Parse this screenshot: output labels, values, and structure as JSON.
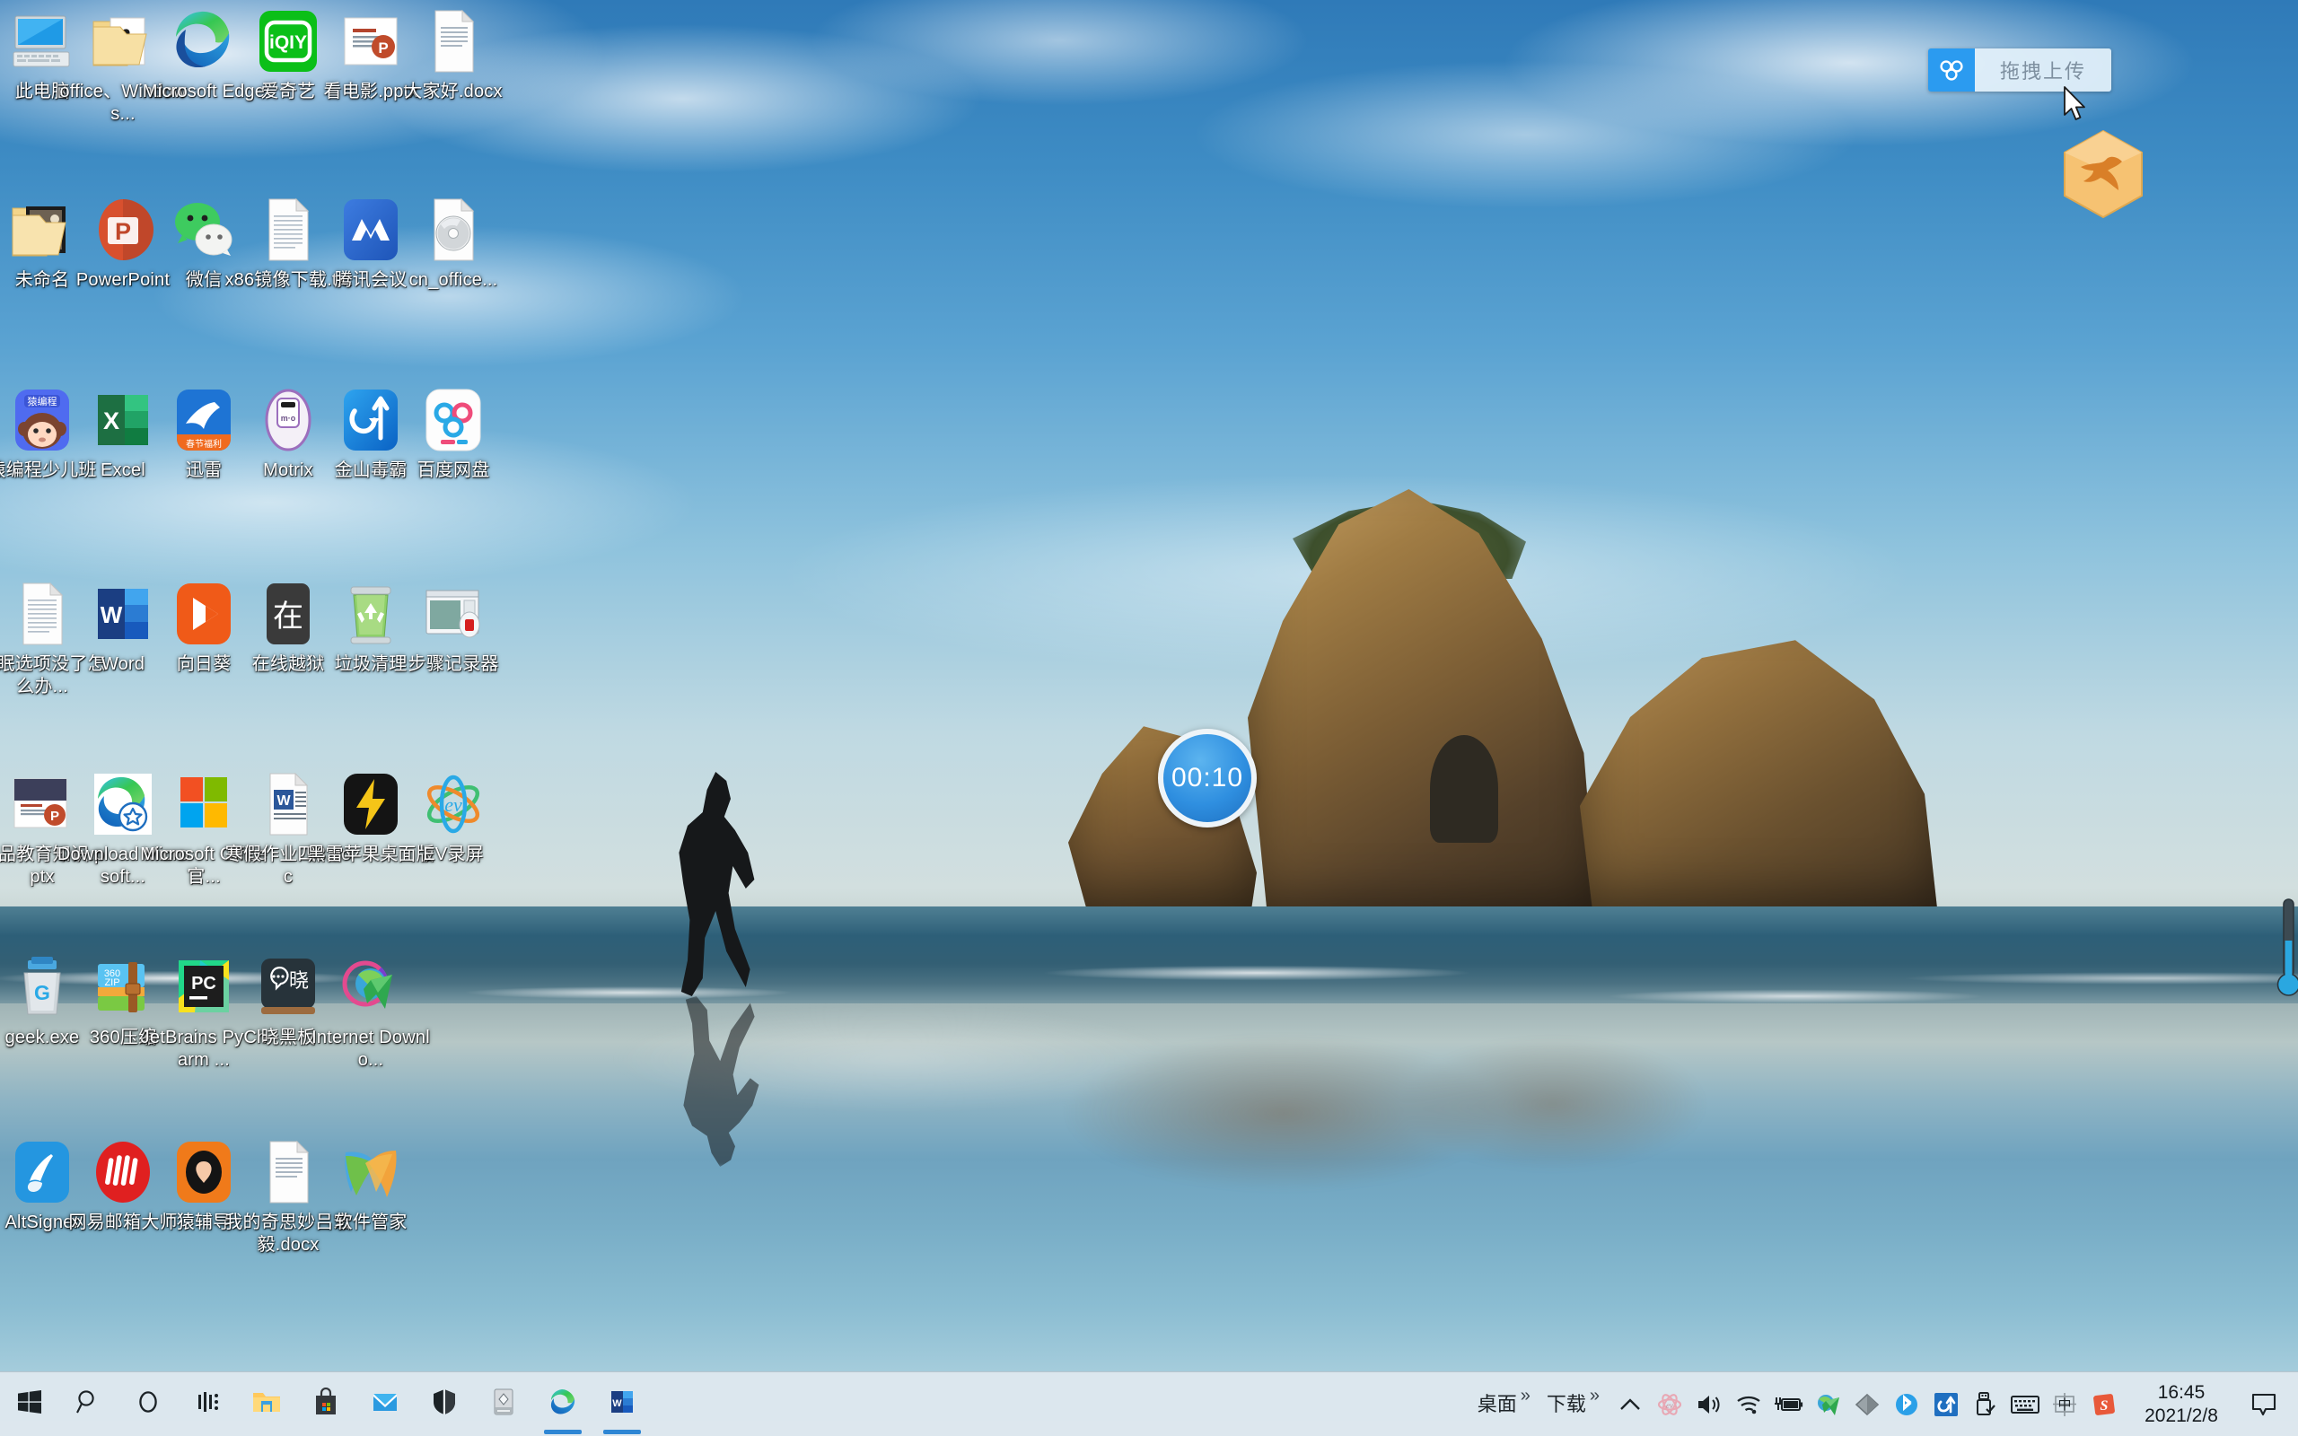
{
  "desktop": {
    "icons": [
      {
        "label": "此电脑",
        "art": "this-pc-icon",
        "col": 0,
        "row": 0
      },
      {
        "label": "office、Windows...",
        "art": "folder-dragon-icon",
        "col": 1,
        "row": 0
      },
      {
        "label": "Microsoft Edge",
        "art": "microsoft-edge-icon",
        "col": 2,
        "row": 0
      },
      {
        "label": "爱奇艺",
        "art": "iqiyi-icon",
        "col": 3,
        "row": 0
      },
      {
        "label": "看电影.pptx",
        "art": "pptx-file-icon",
        "col": 4,
        "row": 0
      },
      {
        "label": "大家好.docx",
        "art": "blank-doc-icon",
        "col": 5,
        "row": 0
      },
      {
        "label": "未命名",
        "art": "folder-picture-icon",
        "col": 0,
        "row": 1
      },
      {
        "label": "PowerPoint",
        "art": "powerpoint-icon",
        "col": 1,
        "row": 1
      },
      {
        "label": "微信",
        "art": "wechat-icon",
        "col": 2,
        "row": 1
      },
      {
        "label": "x86镜像下载.txt",
        "art": "txt-file-icon",
        "col": 3,
        "row": 1
      },
      {
        "label": "腾讯会议",
        "art": "tencent-meeting-icon",
        "col": 4,
        "row": 1
      },
      {
        "label": "cn_office...",
        "art": "iso-disc-icon",
        "col": 5,
        "row": 1
      },
      {
        "label": "猿编程少儿班",
        "art": "yuanbiancheng-icon",
        "col": 0,
        "row": 2
      },
      {
        "label": "Excel",
        "art": "excel-icon",
        "col": 1,
        "row": 2
      },
      {
        "label": "迅雷",
        "art": "xunlei-icon",
        "col": 2,
        "row": 2
      },
      {
        "label": "Motrix",
        "art": "motrix-icon",
        "col": 3,
        "row": 2
      },
      {
        "label": "金山毒霸",
        "art": "kingsoft-antivirus-icon",
        "col": 4,
        "row": 2
      },
      {
        "label": "百度网盘",
        "art": "baidu-netdisk-icon",
        "col": 5,
        "row": 2
      },
      {
        "label": "休眠选项没了怎么办...",
        "art": "txt-file-icon",
        "col": 0,
        "row": 3
      },
      {
        "label": "Word",
        "art": "word-icon",
        "col": 1,
        "row": 3
      },
      {
        "label": "向日葵",
        "art": "sunlogin-icon",
        "col": 2,
        "row": 3
      },
      {
        "label": "在线越狱",
        "art": "zai-jailbreak-icon",
        "col": 3,
        "row": 3
      },
      {
        "label": "垃圾清理",
        "art": "recycle-clean-icon",
        "col": 4,
        "row": 3
      },
      {
        "label": "步骤记录器",
        "art": "steps-recorder-icon",
        "col": 5,
        "row": 3
      },
      {
        "label": "毒品教育知识.pptx",
        "art": "pptx-dark-file-icon",
        "col": 0,
        "row": 4
      },
      {
        "label": "Download Microsoft...",
        "art": "edge-shortcut-icon",
        "col": 1,
        "row": 4
      },
      {
        "label": "Microsoft Office官...",
        "art": "microsoft-logo-icon",
        "col": 2,
        "row": 4
      },
      {
        "label": "寒假作业四3.doc",
        "art": "word-doc-file-icon",
        "col": 3,
        "row": 4
      },
      {
        "label": "黑雷苹果桌面版",
        "art": "heilei-icon",
        "col": 4,
        "row": 4
      },
      {
        "label": "EV录屏",
        "art": "ev-recorder-icon",
        "col": 5,
        "row": 4
      },
      {
        "label": "geek.exe",
        "art": "geek-uninstaller-icon",
        "col": 0,
        "row": 5
      },
      {
        "label": "360压缩",
        "art": "360-zip-icon",
        "col": 1,
        "row": 5
      },
      {
        "label": "JetBrains PyCharm ...",
        "art": "pycharm-icon",
        "col": 2,
        "row": 5
      },
      {
        "label": "晓黑板",
        "art": "xiaoheiban-icon",
        "col": 3,
        "row": 5
      },
      {
        "label": "Internet Downlo...",
        "art": "idm-icon",
        "col": 4,
        "row": 5
      },
      {
        "label": "AltSigner",
        "art": "altsigner-icon",
        "col": 0,
        "row": 6
      },
      {
        "label": "网易邮箱大师",
        "art": "netease-mail-icon",
        "col": 1,
        "row": 6
      },
      {
        "label": "猿辅导",
        "art": "yuanfudao-icon",
        "col": 2,
        "row": 6
      },
      {
        "label": "我的奇思妙吕宏毅.docx",
        "art": "blank-doc-icon",
        "col": 3,
        "row": 6
      },
      {
        "label": "软件管家",
        "art": "software-manager-icon",
        "col": 4,
        "row": 6
      }
    ]
  },
  "upload_widget": {
    "label": "拖拽上传",
    "icon": "baidu-netdisk-cloud-icon"
  },
  "timer_widget": {
    "value": "00:10"
  },
  "taskbar": {
    "left_buttons": [
      {
        "name": "start-button",
        "icon": "windows-logo-icon",
        "running": false
      },
      {
        "name": "search-button",
        "icon": "search-icon",
        "running": false
      },
      {
        "name": "cortana-button",
        "icon": "cortana-circle-icon",
        "running": false
      },
      {
        "name": "task-view-button",
        "icon": "task-view-icon",
        "running": false
      },
      {
        "name": "file-explorer-button",
        "icon": "file-explorer-icon",
        "running": false
      },
      {
        "name": "microsoft-store-button",
        "icon": "microsoft-store-icon",
        "running": false
      },
      {
        "name": "mail-button",
        "icon": "mail-icon",
        "running": false
      },
      {
        "name": "windows-security-button",
        "icon": "shield-icon",
        "running": false
      },
      {
        "name": "scanner-button",
        "icon": "scanner-icon",
        "running": false
      },
      {
        "name": "edge-taskbar-button",
        "icon": "microsoft-edge-icon",
        "running": true
      },
      {
        "name": "word-taskbar-button",
        "icon": "word-icon",
        "running": true
      }
    ],
    "toolbars": [
      {
        "label": "桌面",
        "chevron": "»"
      },
      {
        "label": "下载",
        "chevron": "»"
      }
    ],
    "tray_icons": [
      {
        "name": "show-hidden-icons-button",
        "icon": "chevron-up-icon"
      },
      {
        "name": "ev-recorder-tray-icon",
        "icon": "ev-flower-icon"
      },
      {
        "name": "volume-tray-icon",
        "icon": "speaker-icon"
      },
      {
        "name": "network-tray-icon",
        "icon": "wifi-icon"
      },
      {
        "name": "battery-tray-icon",
        "icon": "battery-charging-icon"
      },
      {
        "name": "idm-tray-icon",
        "icon": "idm-globe-icon"
      },
      {
        "name": "diamond-tray-icon",
        "icon": "diamond-icon"
      },
      {
        "name": "bluetooth-tray-icon",
        "icon": "bluetooth-icon"
      },
      {
        "name": "kingsoft-tray-icon",
        "icon": "kingsoft-arrow-icon"
      },
      {
        "name": "safely-remove-hardware-icon",
        "icon": "usb-eject-icon"
      },
      {
        "name": "touch-keyboard-button",
        "icon": "keyboard-icon"
      },
      {
        "name": "ime-mode-icon",
        "icon": "chinese-ime-icon",
        "glyph": "中"
      },
      {
        "name": "sogou-ime-tray-icon",
        "icon": "sogou-s-icon",
        "glyph": "S"
      }
    ],
    "clock": {
      "time": "16:45",
      "date": "2021/2/8"
    },
    "notification_center": {
      "icon": "notification-bubble-icon"
    }
  }
}
